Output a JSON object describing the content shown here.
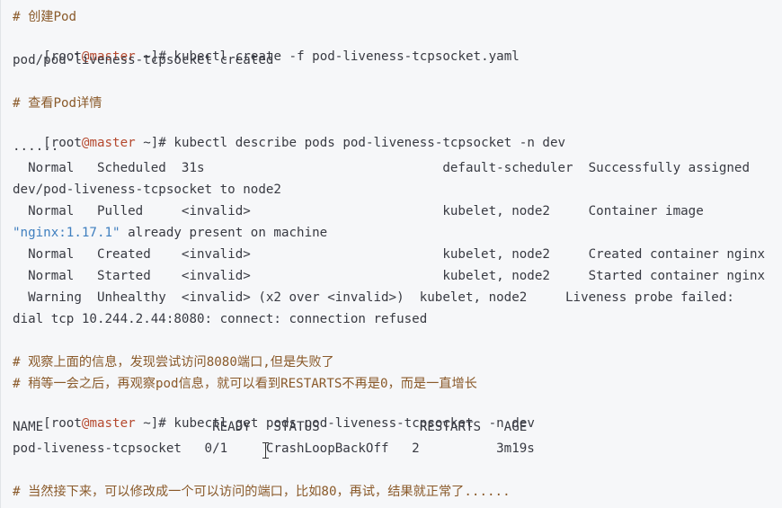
{
  "prompt": {
    "open": "[root",
    "at": "@",
    "host": "master",
    "path": " ~]# "
  },
  "lines": {
    "c1": "# 创建Pod",
    "cmd1": "kubectl create -f pod-liveness-tcpsocket.yaml",
    "out1": "pod/pod-liveness-tcpsocket created",
    "c2": "# 查看Pod详情",
    "cmd2": "kubectl describe pods pod-liveness-tcpsocket -n dev",
    "dots": "......",
    "ev1": "  Normal   Scheduled  31s                               default-scheduler  Successfully assigned",
    "ev1b": "dev/pod-liveness-tcpsocket to node2",
    "ev2": "  Normal   Pulled     <invalid>                         kubelet, node2     Container image",
    "ev2b_str": "\"nginx:1.17.1\"",
    "ev2b_rest": " already present on machine",
    "ev3": "  Normal   Created    <invalid>                         kubelet, node2     Created container nginx",
    "ev4": "  Normal   Started    <invalid>                         kubelet, node2     Started container nginx",
    "ev5": "  Warning  Unhealthy  <invalid> (x2 over <invalid>)  kubelet, node2     Liveness probe failed:",
    "ev5b": "dial tcp 10.244.2.44:8080: connect: connection refused",
    "c3": "# 观察上面的信息，发现尝试访问8080端口,但是失败了",
    "c4": "# 稍等一会之后，再观察pod信息，就可以看到RESTARTS不再是0，而是一直增长",
    "cmd3": "kubectl get pods pod-liveness-tcpsocket  -n dev",
    "hdr": "NAME                      READY   STATUS             RESTARTS   AGE",
    "row": "pod-liveness-tcpsocket   0/1     CrashLoopBackOff   2          3m19s",
    "c5": "# 当然接下来，可以修改成一个可以访问的端口，比如80，再试，结果就正常了......"
  }
}
